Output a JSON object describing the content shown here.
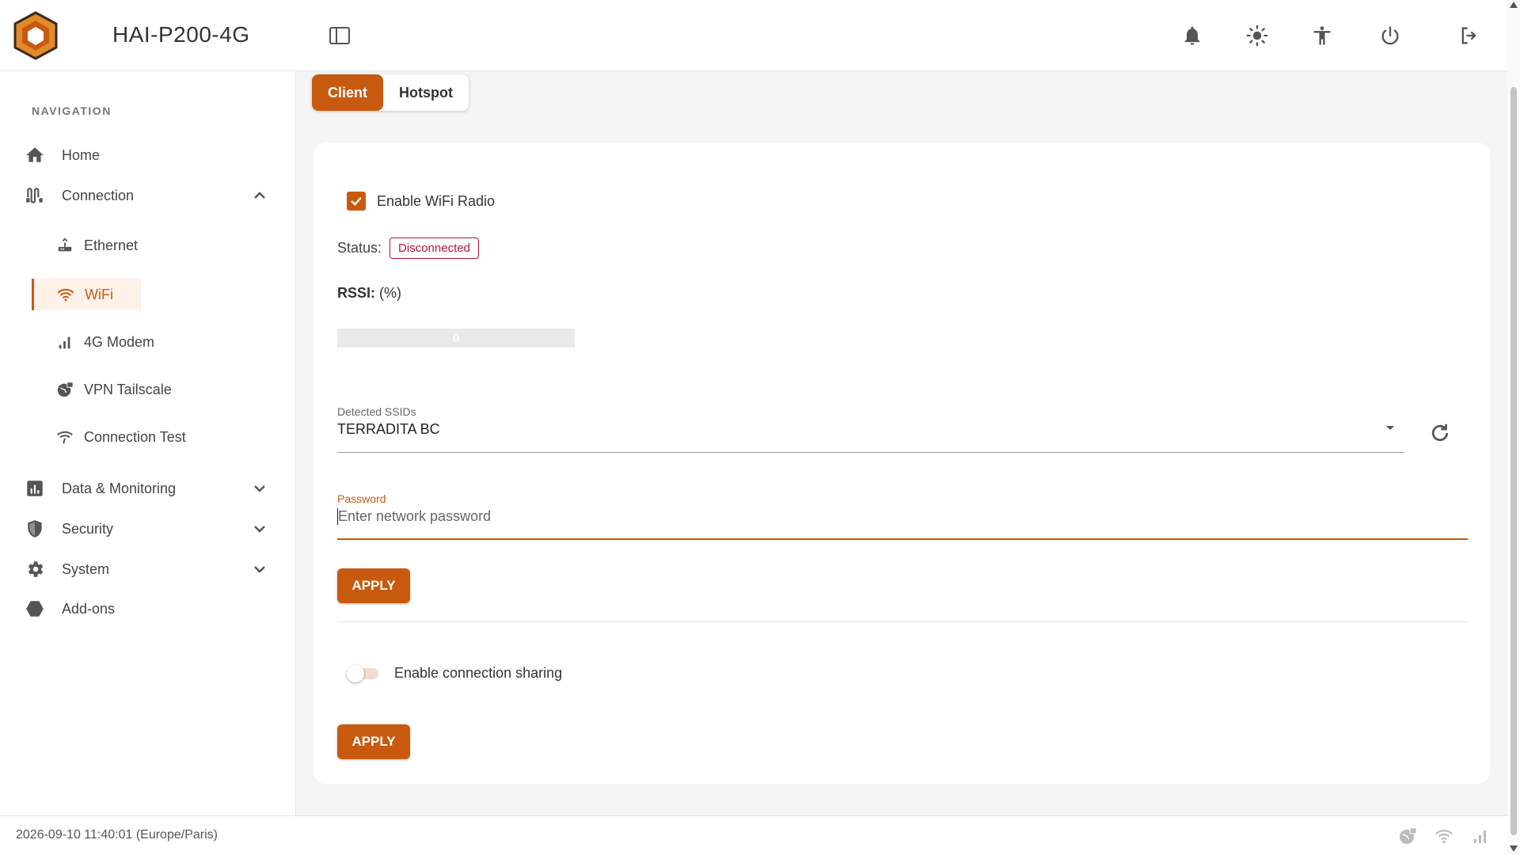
{
  "header": {
    "title": "HAI-P200-4G",
    "icons": [
      "notifications-icon",
      "theme-brightness-icon",
      "accessibility-icon",
      "power-icon",
      "logout-icon"
    ]
  },
  "sidebar": {
    "heading": "NAVIGATION",
    "items": [
      {
        "label": "Home",
        "icon": "home-icon"
      },
      {
        "label": "Connection",
        "icon": "connection-icon",
        "expanded": true
      },
      {
        "label": "Data & Monitoring",
        "icon": "chart-icon",
        "expanded": false
      },
      {
        "label": "Security",
        "icon": "shield-icon",
        "expanded": false
      },
      {
        "label": "System",
        "icon": "gear-icon",
        "expanded": false
      },
      {
        "label": "Add-ons",
        "icon": "hexagon-icon"
      }
    ],
    "connection_sub": [
      {
        "label": "Ethernet",
        "icon": "router-icon"
      },
      {
        "label": "WiFi",
        "icon": "wifi-icon",
        "active": true
      },
      {
        "label": "4G Modem",
        "icon": "signal-bars-icon"
      },
      {
        "label": "VPN Tailscale",
        "icon": "vpn-globe-icon"
      },
      {
        "label": "Connection Test",
        "icon": "wifi-test-icon"
      }
    ]
  },
  "tabs": [
    {
      "label": "Client",
      "active": true
    },
    {
      "label": "Hotspot",
      "active": false
    }
  ],
  "wifi": {
    "enable_label": "Enable WiFi Radio",
    "enabled": true,
    "status_label": "Status:",
    "status_value": "Disconnected",
    "rssi_label": "RSSI:",
    "rssi_unit": "(%)",
    "rssi_value": "0",
    "rssi_percent": 0,
    "ssid_label": "Detected SSIDs",
    "ssid_value": "TERRADITA BC",
    "password_label": "Password",
    "password_placeholder": "Enter network password",
    "apply_label": "APPLY",
    "sharing_label": "Enable connection sharing",
    "sharing_enabled": false,
    "apply2_label": "APPLY"
  },
  "footer": {
    "datetime": "2026-09-10 11:40:01 (Europe/Paris)",
    "icons": [
      "vpn-status-icon",
      "wifi-status-icon",
      "cellular-status-icon"
    ]
  },
  "colors": {
    "accent": "#c85a10",
    "error": "#b0153a"
  }
}
